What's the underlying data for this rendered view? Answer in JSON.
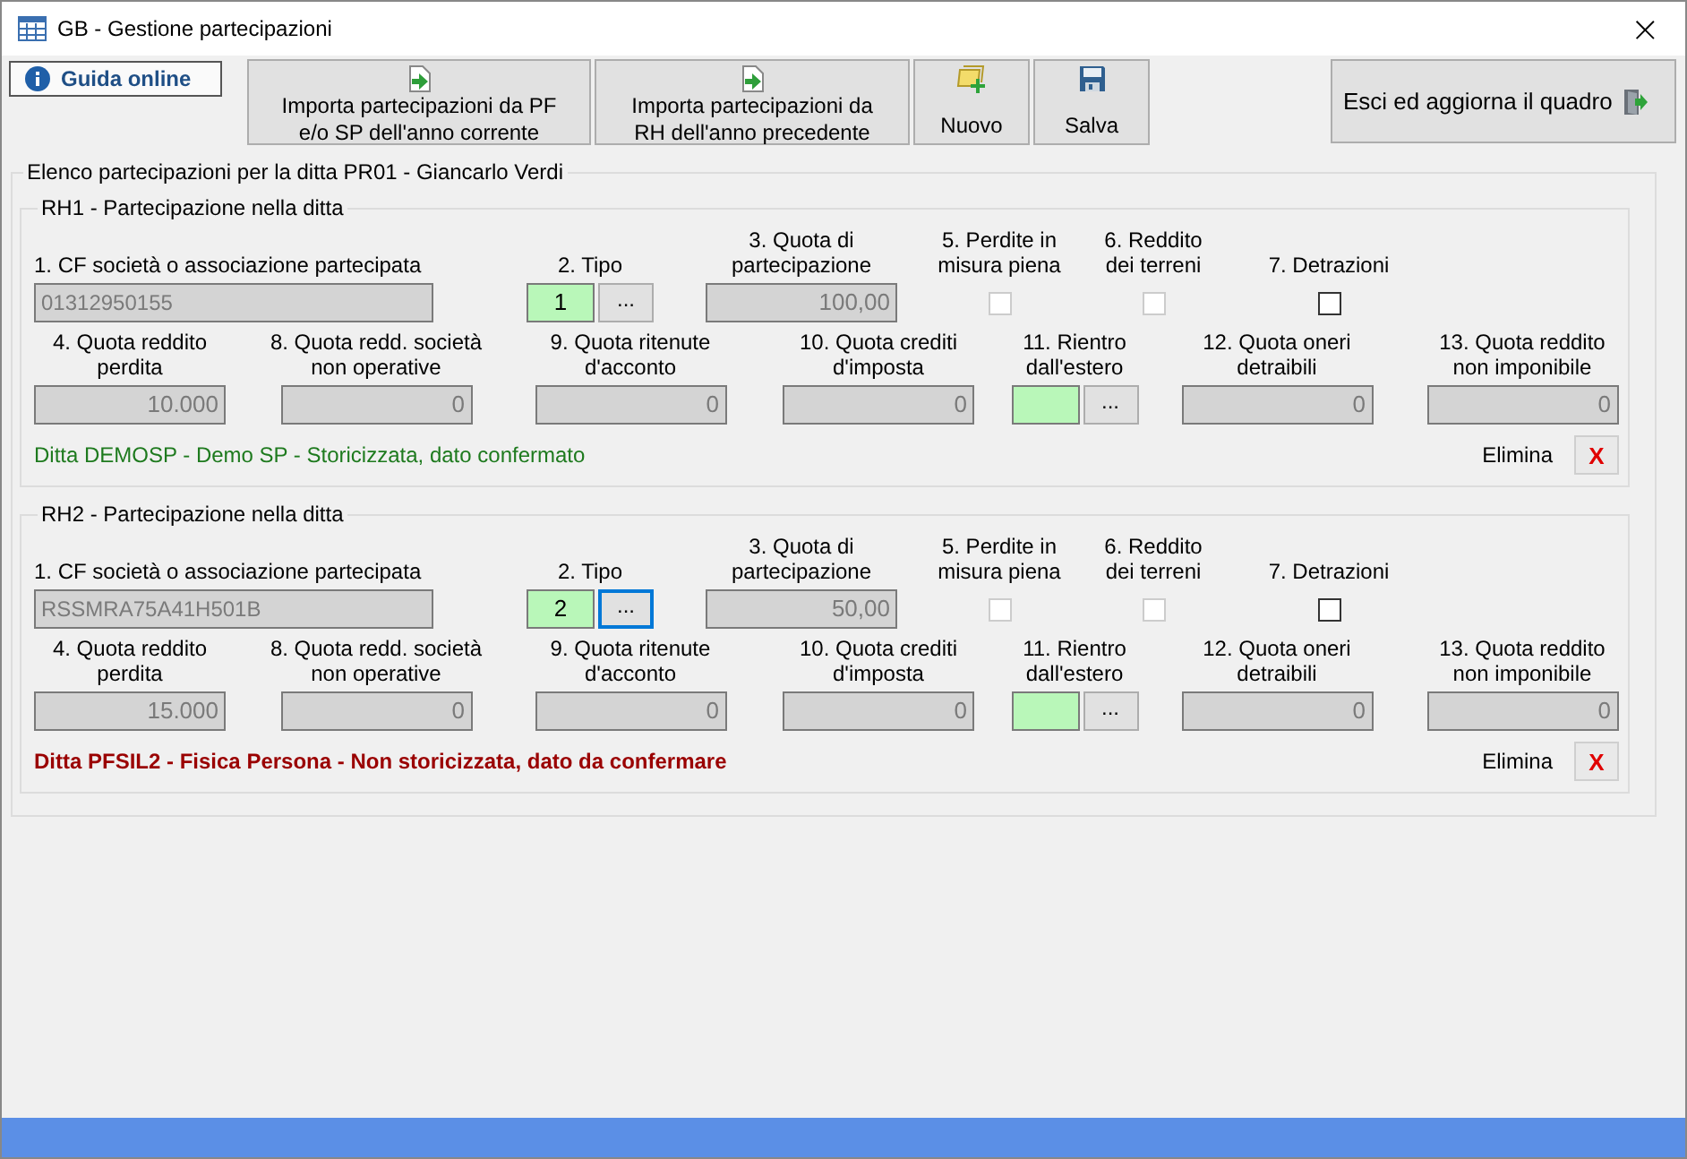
{
  "window": {
    "title": "GB - Gestione partecipazioni",
    "close": "×"
  },
  "toolbar": {
    "help_link": "Guida online",
    "buttons": [
      {
        "label": "Importa partecipazioni da PF e/o SP dell'anno corrente",
        "kind": "import"
      },
      {
        "label": "Importa partecipazioni da RH dell'anno precedente",
        "kind": "import"
      },
      {
        "label": "Nuovo",
        "kind": "new"
      },
      {
        "label": "Salva",
        "kind": "save"
      }
    ],
    "exit_button": "Esci ed aggiorna il quadro"
  },
  "list_title": "Elenco partecipazioni per la ditta PR01 - Giancarlo Verdi",
  "records": [
    {
      "title": "RH1 - Partecipazione nella ditta",
      "row1": [
        {
          "kind": "text",
          "label": "1. CF società o associazione partecipata",
          "value": "01312950155"
        },
        {
          "kind": "code",
          "label": "2. Tipo",
          "value": "1",
          "button": "...",
          "focused": false
        },
        {
          "kind": "number",
          "label": "3. Quota di partecipazione",
          "value": "100,00"
        },
        {
          "kind": "checkbox",
          "label": "5. Perdite in misura piena",
          "checked": false,
          "disabled": true
        },
        {
          "kind": "checkbox",
          "label": "6. Reddito dei terreni",
          "checked": false,
          "disabled": true
        },
        {
          "kind": "checkbox",
          "label": "7. Detrazioni",
          "checked": false,
          "disabled": false
        }
      ],
      "row2": [
        {
          "kind": "number",
          "label": "4. Quota reddito perdita",
          "value": "10.000"
        },
        {
          "kind": "number",
          "label": "8. Quota redd. società non operative",
          "value": "0"
        },
        {
          "kind": "number",
          "label": "9. Quota ritenute d'acconto",
          "value": "0"
        },
        {
          "kind": "number",
          "label": "10. Quota crediti d'imposta",
          "value": "0"
        },
        {
          "kind": "code",
          "label": "11. Rientro dall'estero",
          "button": "...",
          "focused": false
        },
        {
          "kind": "number",
          "label": "12. Quota oneri detraibili",
          "value": "0"
        },
        {
          "kind": "number",
          "label": "13. Quota reddito non imponibile",
          "value": "0"
        }
      ],
      "status": {
        "text": "Ditta DEMOSP - Demo SP - Storicizzata, dato confermato",
        "kind": "confirmed"
      },
      "delete_label": "Elimina",
      "delete_button": "X"
    },
    {
      "title": "RH2 - Partecipazione nella ditta",
      "row1": [
        {
          "kind": "text",
          "label": "1. CF società o associazione partecipata",
          "value": "RSSMRA75A41H501B"
        },
        {
          "kind": "code",
          "label": "2. Tipo",
          "value": "2",
          "button": "...",
          "focused": true
        },
        {
          "kind": "number",
          "label": "3. Quota di partecipazione",
          "value": "50,00"
        },
        {
          "kind": "checkbox",
          "label": "5. Perdite in misura piena",
          "checked": false,
          "disabled": true
        },
        {
          "kind": "checkbox",
          "label": "6. Reddito dei terreni",
          "checked": false,
          "disabled": true
        },
        {
          "kind": "checkbox",
          "label": "7. Detrazioni",
          "checked": false,
          "disabled": false
        }
      ],
      "row2": [
        {
          "kind": "number",
          "label": "4. Quota reddito perdita",
          "value": "15.000"
        },
        {
          "kind": "number",
          "label": "8. Quota redd. società non operative",
          "value": "0"
        },
        {
          "kind": "number",
          "label": "9. Quota ritenute d'acconto",
          "value": "0"
        },
        {
          "kind": "number",
          "label": "10. Quota crediti d'imposta",
          "value": "0"
        },
        {
          "kind": "code",
          "label": "11. Rientro dall'estero",
          "button": "...",
          "focused": false
        },
        {
          "kind": "number",
          "label": "12. Quota oneri detraibili",
          "value": "0"
        },
        {
          "kind": "number",
          "label": "13. Quota reddito non imponibile",
          "value": "0"
        }
      ],
      "status": {
        "text": "Ditta PFSIL2 - Fisica Persona - Non storicizzata, dato da confermare",
        "kind": "pending"
      },
      "delete_label": "Elimina",
      "delete_button": "X"
    }
  ]
}
